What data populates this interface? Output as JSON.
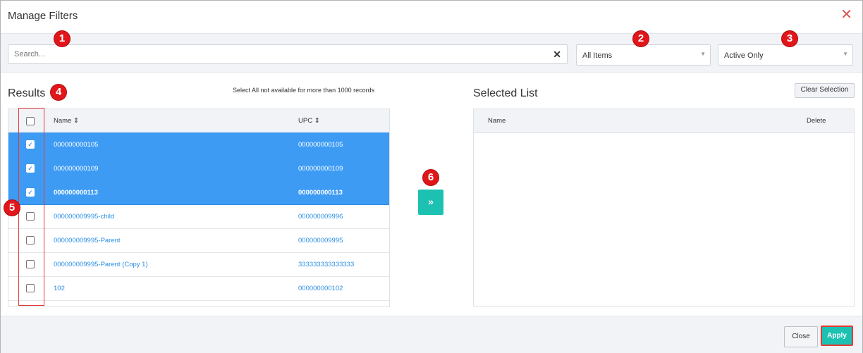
{
  "dialog": {
    "title": "Manage Filters",
    "close_icon": "close-icon"
  },
  "search": {
    "placeholder": "Search...",
    "value": ""
  },
  "filters": {
    "items_select": "All Items",
    "status_select": "Active Only"
  },
  "badges": [
    "1",
    "2",
    "3",
    "4",
    "5",
    "6"
  ],
  "results": {
    "title": "Results",
    "note": "Select All not available for more than 1000 records",
    "columns": [
      "Name",
      "UPC"
    ],
    "sort_icon": "sort-icon",
    "rows": [
      {
        "name": "000000000105",
        "upc": "000000000105",
        "checked": true,
        "selected": true
      },
      {
        "name": "000000000109",
        "upc": "000000000109",
        "checked": true,
        "selected": true
      },
      {
        "name": "000000000113",
        "upc": "000000000113",
        "checked": true,
        "selected": true
      },
      {
        "name": "000000009995-child",
        "upc": "000000009996",
        "checked": false,
        "selected": false
      },
      {
        "name": "000000009995-Parent",
        "upc": "000000009995",
        "checked": false,
        "selected": false
      },
      {
        "name": "000000009995-Parent (Copy 1)",
        "upc": "333333333333333",
        "checked": false,
        "selected": false
      },
      {
        "name": "102",
        "upc": "000000000102",
        "checked": false,
        "selected": false
      }
    ]
  },
  "move_button": {
    "label": "»"
  },
  "selected_list": {
    "title": "Selected List",
    "clear_label": "Clear Selection",
    "columns": [
      "Name",
      "Delete"
    ]
  },
  "footer": {
    "close_label": "Close",
    "apply_label": "Apply"
  },
  "colors": {
    "accent": "#1cc1b2",
    "selection": "#3d9bf4",
    "annotation": "#e0161b"
  }
}
